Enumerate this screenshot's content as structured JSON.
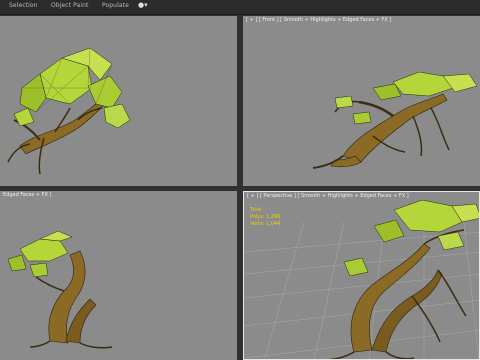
{
  "toolbar": {
    "items": [
      {
        "label": "Selection"
      },
      {
        "label": "Object Paint"
      },
      {
        "label": "Populate"
      }
    ],
    "extra": "●▾"
  },
  "viewports": {
    "top_left": {
      "label": ""
    },
    "top_right": {
      "label": "[ + ] [ Front ] [ Smooth + Highlights + Edged Faces + FX ]"
    },
    "bottom_left": {
      "label": "Edged Faces + FX ]"
    },
    "bottom_right": {
      "label": "[ + ] [ Perspective ] [ Smooth + Highlights + Edged Faces + FX ]"
    }
  },
  "stats": {
    "title": "Total",
    "polys": "Polys: 1,296",
    "verts": "Verts: 1,044"
  },
  "colors": {
    "viewport_bg": "#8b8b8b",
    "bark": "#8a6a25",
    "leaf": "#b5d63a",
    "stats_text": "#f0d100"
  }
}
